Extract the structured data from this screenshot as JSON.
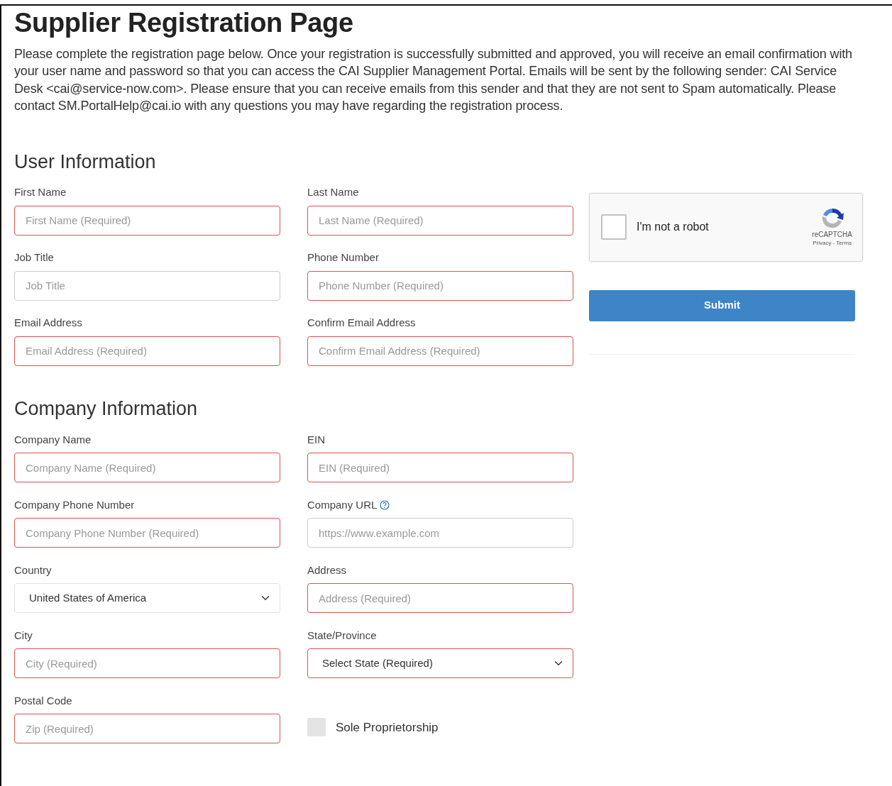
{
  "title": "Supplier Registration Page",
  "intro": "Please complete the registration page below. Once your registration is successfully submitted and approved, you will receive an email confirmation with your user name and password so that you can access the CAI Supplier Management Portal. Emails will be sent by the following sender: CAI Service Desk <cai@service-now.com>. Please ensure that you can receive emails from this sender and that they are not sent to Spam automatically. Please contact SM.PortalHelp@cai.io with any questions you may have regarding the registration process.",
  "sections": [
    {
      "heading": "User Information",
      "fields": [
        {
          "kind": "input",
          "label": "First Name",
          "placeholder": "First Name (Required)",
          "required": true
        },
        {
          "kind": "input",
          "label": "Last Name",
          "placeholder": "Last Name (Required)",
          "required": true
        },
        {
          "kind": "input",
          "label": "Job Title",
          "placeholder": "Job Title",
          "required": false
        },
        {
          "kind": "input",
          "label": "Phone Number",
          "placeholder": "Phone Number (Required)",
          "required": true
        },
        {
          "kind": "input",
          "label": "Email Address",
          "placeholder": "Email Address (Required)",
          "required": true
        },
        {
          "kind": "input",
          "label": "Confirm Email Address",
          "placeholder": "Confirm Email Address (Required)",
          "required": true
        }
      ]
    },
    {
      "heading": "Company Information",
      "fields": [
        {
          "kind": "input",
          "label": "Company Name",
          "placeholder": "Company Name (Required)",
          "required": true
        },
        {
          "kind": "input",
          "label": "EIN",
          "placeholder": "EIN (Required)",
          "required": true
        },
        {
          "kind": "input",
          "label": "Company Phone Number",
          "placeholder": "Company Phone Number (Required)",
          "required": true
        },
        {
          "kind": "input",
          "label": "Company URL",
          "help": true,
          "placeholder": "https://www.example.com",
          "required": false
        },
        {
          "kind": "select",
          "label": "Country",
          "value": "United States of America",
          "required": false
        },
        {
          "kind": "input",
          "label": "Address",
          "placeholder": "Address (Required)",
          "required": true
        },
        {
          "kind": "input",
          "label": "City",
          "placeholder": "City (Required)",
          "required": true
        },
        {
          "kind": "select",
          "label": "State/Province",
          "value": "Select State (Required)",
          "required": true
        },
        {
          "kind": "input",
          "label": "Postal Code",
          "placeholder": "Zip (Required)",
          "required": true
        },
        {
          "kind": "checkbox",
          "label": "Sole Proprietorship",
          "checked": false
        }
      ]
    }
  ],
  "captcha": {
    "label": "I'm not a robot",
    "checked": false,
    "brand": "reCAPTCHA",
    "links": "Privacy - Terms"
  },
  "submit": "Submit"
}
